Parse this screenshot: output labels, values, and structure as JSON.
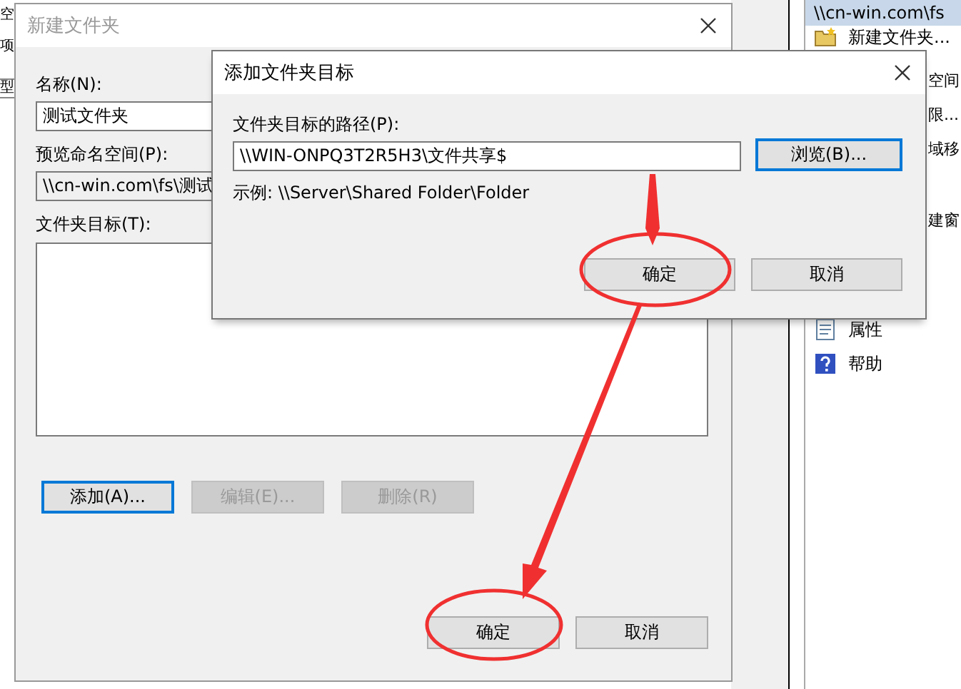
{
  "back_window": {
    "fragments": [
      "空",
      "项",
      "型"
    ]
  },
  "actions_panel": {
    "header": "\\\\cn-win.com\\fs",
    "items_top": [
      "新建文件夹..."
    ],
    "items_cut": [
      "空间",
      "限...",
      "域移",
      "建窗"
    ],
    "items_bottom": [
      "属性",
      "帮助"
    ]
  },
  "new_folder_dialog": {
    "title": "新建文件夹",
    "active": false,
    "name_label": "名称(N):",
    "name_value": "测试文件夹",
    "preview_label": "预览命名空间(P):",
    "preview_value": "\\\\cn-win.com\\fs\\测试",
    "targets_label": "文件夹目标(T):",
    "buttons": [
      {
        "label": "添加(A)...",
        "disabled": false,
        "focused": true
      },
      {
        "label": "编辑(E)...",
        "disabled": true,
        "focused": false
      },
      {
        "label": "删除(R)",
        "disabled": true,
        "focused": false
      }
    ],
    "ok": "确定",
    "cancel": "取消"
  },
  "add_target_dialog": {
    "title": "添加文件夹目标",
    "active": true,
    "path_label": "文件夹目标的路径(P):",
    "path_value": "\\\\WIN-ONPQ3T2R5H3\\文件共享$",
    "browse": {
      "label": "浏览(B)...",
      "focused": true
    },
    "example": "示例: \\\\Server\\Shared Folder\\Folder",
    "ok": "确定",
    "cancel": "取消"
  }
}
